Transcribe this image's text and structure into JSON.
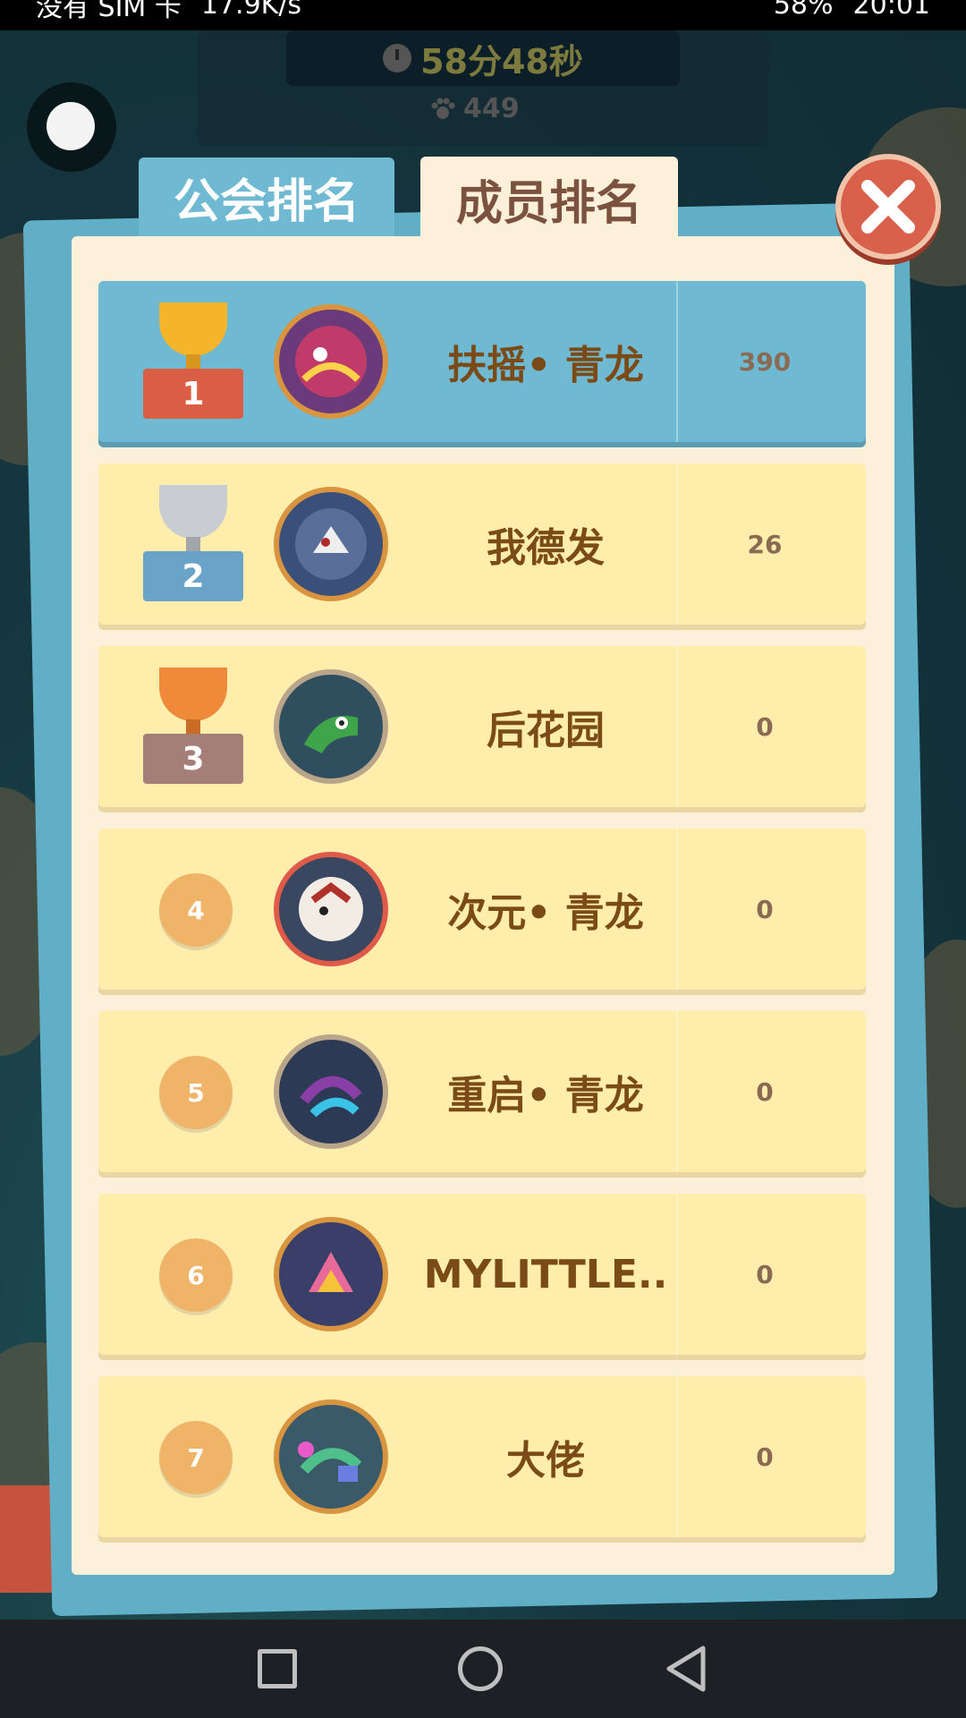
{
  "status_bar": {
    "carrier": "没有 SIM 卡",
    "speed": "17.9K/s",
    "battery": "58%",
    "time": "20:01"
  },
  "top": {
    "timer": "58分48秒",
    "paw_count": "449"
  },
  "tabs": [
    {
      "label": "公会排名",
      "active": false
    },
    {
      "label": "成员排名",
      "active": true
    }
  ],
  "rankings": [
    {
      "rank": "1",
      "name": "扶摇• 青龙",
      "score": "390"
    },
    {
      "rank": "2",
      "name": "我德发",
      "score": "26"
    },
    {
      "rank": "3",
      "name": "后花园",
      "score": "0"
    },
    {
      "rank": "4",
      "name": "次元• 青龙",
      "score": "0"
    },
    {
      "rank": "5",
      "name": "重启• 青龙",
      "score": "0"
    },
    {
      "rank": "6",
      "name": "MYLITTLE..",
      "score": "0"
    },
    {
      "rank": "7",
      "name": "大佬",
      "score": "0"
    }
  ],
  "colors": {
    "accent_blue": "#6fbad2",
    "row_yellow": "#ffeeab",
    "gold": "#f5b52a",
    "silver": "#c9ccd0",
    "bronze": "#ee8a3a",
    "close_red": "#d9604a"
  },
  "icons": {
    "close": "close-icon",
    "back": "back-arrow-icon",
    "clock": "clock-icon",
    "paw": "paw-icon"
  }
}
